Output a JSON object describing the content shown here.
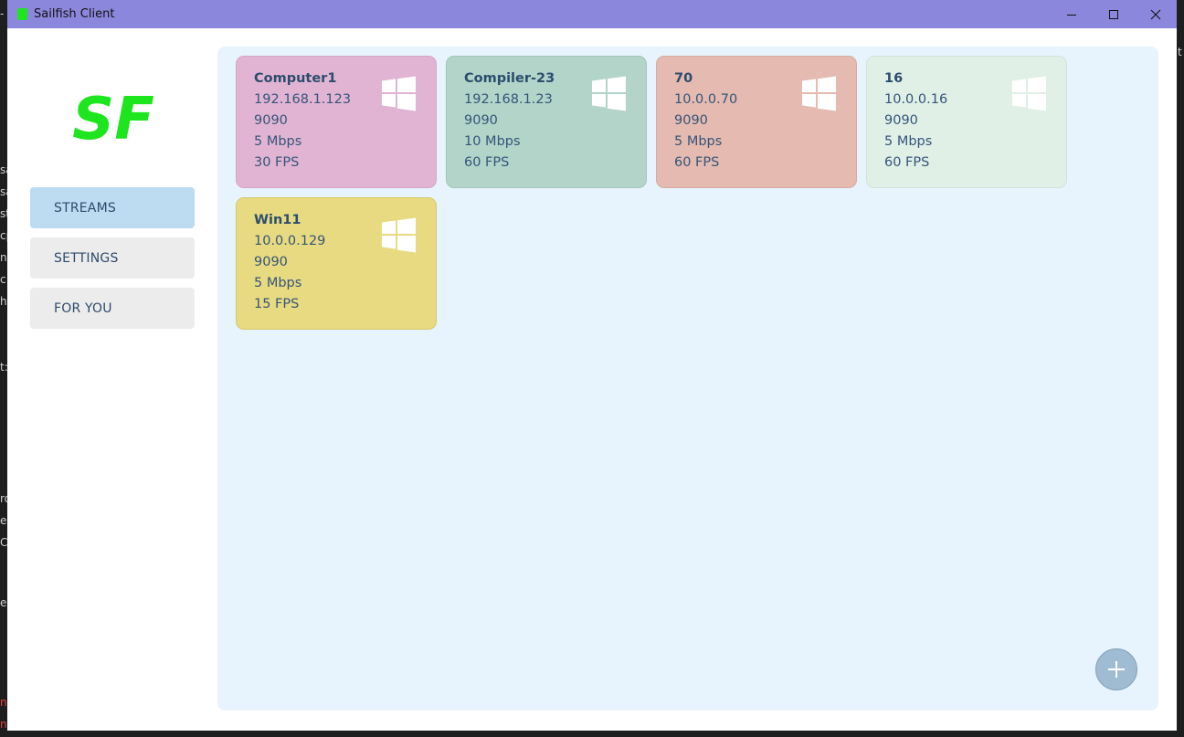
{
  "window": {
    "title": "Sailfish Client"
  },
  "logo": {
    "text": "SF",
    "color": "#1ee61e"
  },
  "nav": {
    "items": [
      {
        "label": "STREAMS",
        "active": true
      },
      {
        "label": "SETTINGS",
        "active": false
      },
      {
        "label": "FOR YOU",
        "active": false
      }
    ]
  },
  "streams": [
    {
      "name": "Computer1",
      "ip": "192.168.1.123",
      "port": "9090",
      "bitrate": "5 Mbps",
      "fps": "30 FPS",
      "color": "#e2b4d3",
      "border": "#d6a3c6",
      "icon": "windows-icon"
    },
    {
      "name": "Compiler-23",
      "ip": "192.168.1.23",
      "port": "9090",
      "bitrate": "10 Mbps",
      "fps": "60 FPS",
      "color": "#b3d4c8",
      "border": "#a2c6b8",
      "icon": "windows-icon"
    },
    {
      "name": "70",
      "ip": "10.0.0.70",
      "port": "9090",
      "bitrate": "5 Mbps",
      "fps": "60 FPS",
      "color": "#e5bab0",
      "border": "#d8aa9f",
      "icon": "windows-icon"
    },
    {
      "name": "16",
      "ip": "10.0.0.16",
      "port": "9090",
      "bitrate": "5 Mbps",
      "fps": "60 FPS",
      "color": "#e0f0e6",
      "border": "#cfe4d7",
      "icon": "windows-icon"
    },
    {
      "name": "Win11",
      "ip": "10.0.0.129",
      "port": "9090",
      "bitrate": "5 Mbps",
      "fps": "15 FPS",
      "color": "#e8da80",
      "border": "#d9c86c",
      "icon": "windows-icon"
    }
  ],
  "add_button": {
    "icon": "plus-icon"
  }
}
